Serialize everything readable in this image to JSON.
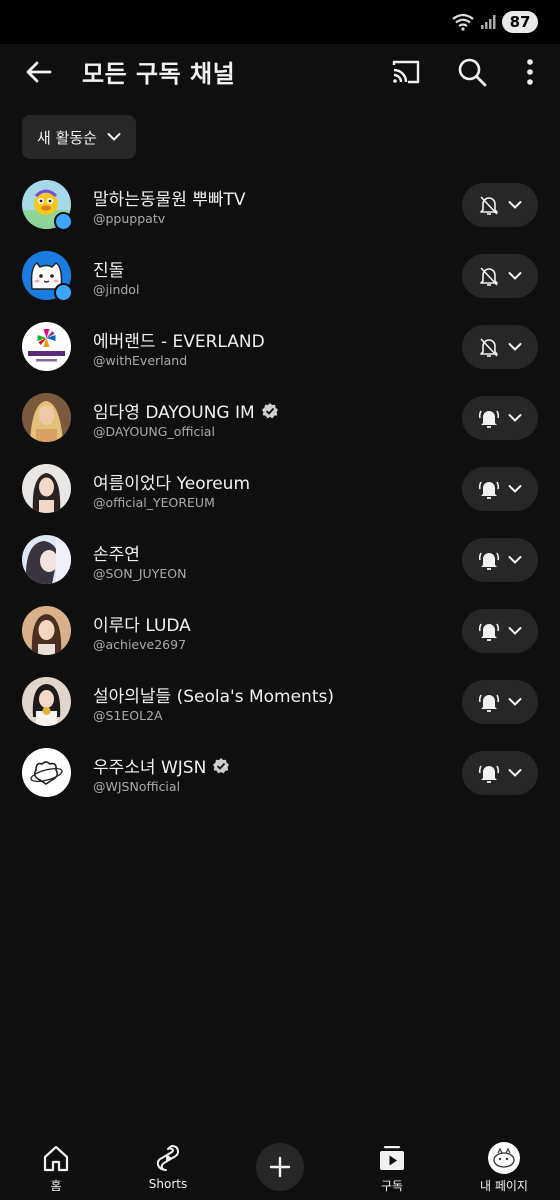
{
  "status": {
    "battery": "87"
  },
  "header": {
    "title": "모든 구독 채널"
  },
  "sort": {
    "label": "새 활동순"
  },
  "channels": [
    {
      "name": "말하는동물원 뿌빠TV",
      "handle": "@ppuppatv",
      "verified": false,
      "new_content": true,
      "notify": "off"
    },
    {
      "name": "진돌",
      "handle": "@jindol",
      "verified": false,
      "new_content": true,
      "notify": "off"
    },
    {
      "name": "에버랜드 - EVERLAND",
      "handle": "@withEverland",
      "verified": false,
      "new_content": false,
      "notify": "off"
    },
    {
      "name": "임다영 DAYOUNG IM",
      "handle": "@DAYOUNG_official",
      "verified": true,
      "new_content": false,
      "notify": "all"
    },
    {
      "name": "여름이었다 Yeoreum",
      "handle": "@official_YEOREUM",
      "verified": false,
      "new_content": false,
      "notify": "all"
    },
    {
      "name": "손주연",
      "handle": "@SON_JUYEON",
      "verified": false,
      "new_content": false,
      "notify": "all"
    },
    {
      "name": "이루다 LUDA",
      "handle": "@achieve2697",
      "verified": false,
      "new_content": false,
      "notify": "all"
    },
    {
      "name": "설아의날들 (Seola's Moments)",
      "handle": "@S1EOL2A",
      "verified": false,
      "new_content": false,
      "notify": "all"
    },
    {
      "name": "우주소녀 WJSN",
      "handle": "@WJSNofficial",
      "verified": true,
      "new_content": false,
      "notify": "all"
    }
  ],
  "nav": {
    "home": "홈",
    "shorts": "Shorts",
    "subscriptions": "구독",
    "you": "내 페이지"
  },
  "colors": {
    "background": "#0f0f0f",
    "surface": "#272727",
    "accent_dot": "#3ea6ff",
    "secondary_text": "#aaaaaa"
  }
}
